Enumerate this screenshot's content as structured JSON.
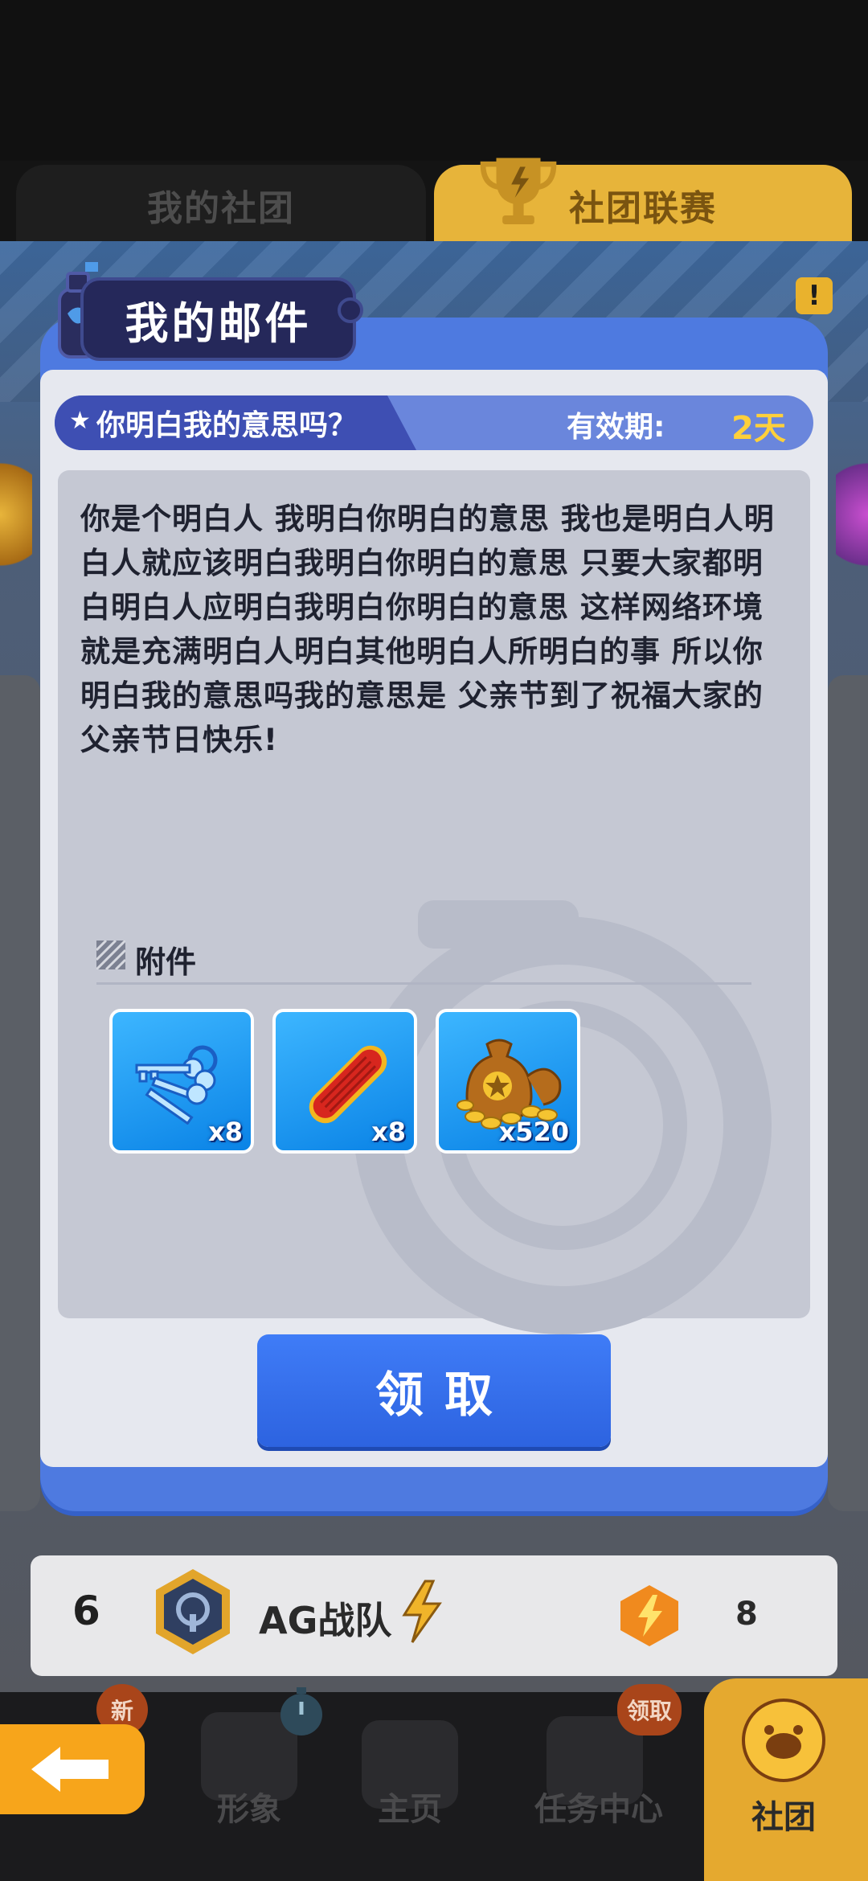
{
  "tabs": {
    "left_label": "我的社团",
    "right_label": "社团联赛"
  },
  "modal": {
    "title": "我的邮件",
    "subject": "你明白我的意思吗？",
    "valid_label": "有效期:",
    "valid_value": "2天",
    "body": "你是个明白人 我明白你明白的意思 我也是明白人明白人就应该明白我明白你明白的意思 只要大家都明白明白人应明白我明白你明白的意思 这样网络环境就是充满明白人明白其他明白人所明白的事 所以你明白我的意思吗我的意思是 父亲节到了祝福大家的父亲节日快乐!",
    "attachments_label": "附件",
    "attachments": [
      {
        "icon": "keys-icon",
        "qty": "x8"
      },
      {
        "icon": "hoverboard-icon",
        "qty": "x8"
      },
      {
        "icon": "coin-bag-icon",
        "qty": "x520"
      }
    ],
    "claim_label": "领取"
  },
  "list_row": {
    "rank": "6",
    "team_name": "AG战队",
    "score": "8"
  },
  "nav": {
    "items": [
      {
        "label": "形象",
        "badge": "新"
      },
      {
        "label": "主页"
      },
      {
        "label": "任务中心",
        "badge": "领取"
      },
      {
        "label": "社团"
      }
    ]
  },
  "colors": {
    "accent_blue": "#2d63e0",
    "gold": "#e5a92f",
    "valid_yellow": "#ffd03a"
  }
}
